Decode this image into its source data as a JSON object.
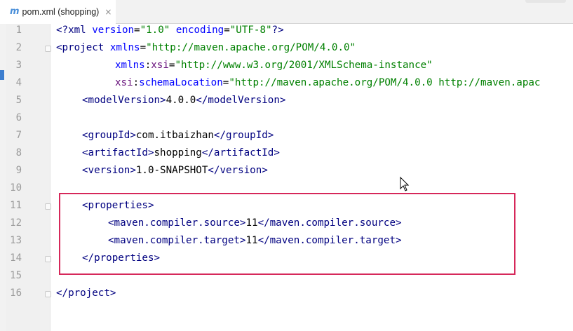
{
  "tab": {
    "icon": "m",
    "label": "pom.xml (shopping)",
    "close": "×"
  },
  "line_numbers": [
    "1",
    "2",
    "3",
    "4",
    "5",
    "6",
    "7",
    "8",
    "9",
    "10",
    "11",
    "12",
    "13",
    "14",
    "15",
    "16"
  ],
  "code": {
    "l1": {
      "a": "<?xml ",
      "b": "version",
      "c": "=",
      "d": "\"1.0\"",
      "e": " ",
      "f": "encoding",
      "g": "=",
      "h": "\"UTF-8\"",
      "i": "?>"
    },
    "l2": {
      "a": "<project ",
      "b": "xmlns",
      "c": "=",
      "d": "\"http://maven.apache.org/POM/4.0.0\""
    },
    "l3": {
      "a": "xmlns",
      "b": ":",
      "c": "xsi",
      "d": "=",
      "e": "\"http://www.w3.org/2001/XMLSchema-instance\""
    },
    "l4": {
      "a": "xsi",
      "b": ":",
      "c": "schemaLocation",
      "d": "=",
      "e": "\"http://maven.apache.org/POM/4.0.0 http://maven.apac"
    },
    "l5": {
      "open": "<modelVersion>",
      "text": "4.0.0",
      "close": "</modelVersion>"
    },
    "l7": {
      "open": "<groupId>",
      "text": "com.itbaizhan",
      "close": "</groupId>"
    },
    "l8": {
      "open": "<artifactId>",
      "text": "shopping",
      "close": "</artifactId>"
    },
    "l9": {
      "open": "<version>",
      "text": "1.0-SNAPSHOT",
      "close": "</version>"
    },
    "l11": {
      "open": "<properties>"
    },
    "l12": {
      "open": "<maven.compiler.source>",
      "text": "11",
      "close": "</maven.compiler.source>"
    },
    "l13": {
      "open": "<maven.compiler.target>",
      "text": "11",
      "close": "</maven.compiler.target>"
    },
    "l14": {
      "close": "</properties>"
    },
    "l16": {
      "close": "</project>"
    }
  },
  "colors": {
    "tag": "#000080",
    "attribute": "#0000ff",
    "namespace": "#660e7a",
    "string": "#008000",
    "highlight_box": "#d6285a"
  }
}
